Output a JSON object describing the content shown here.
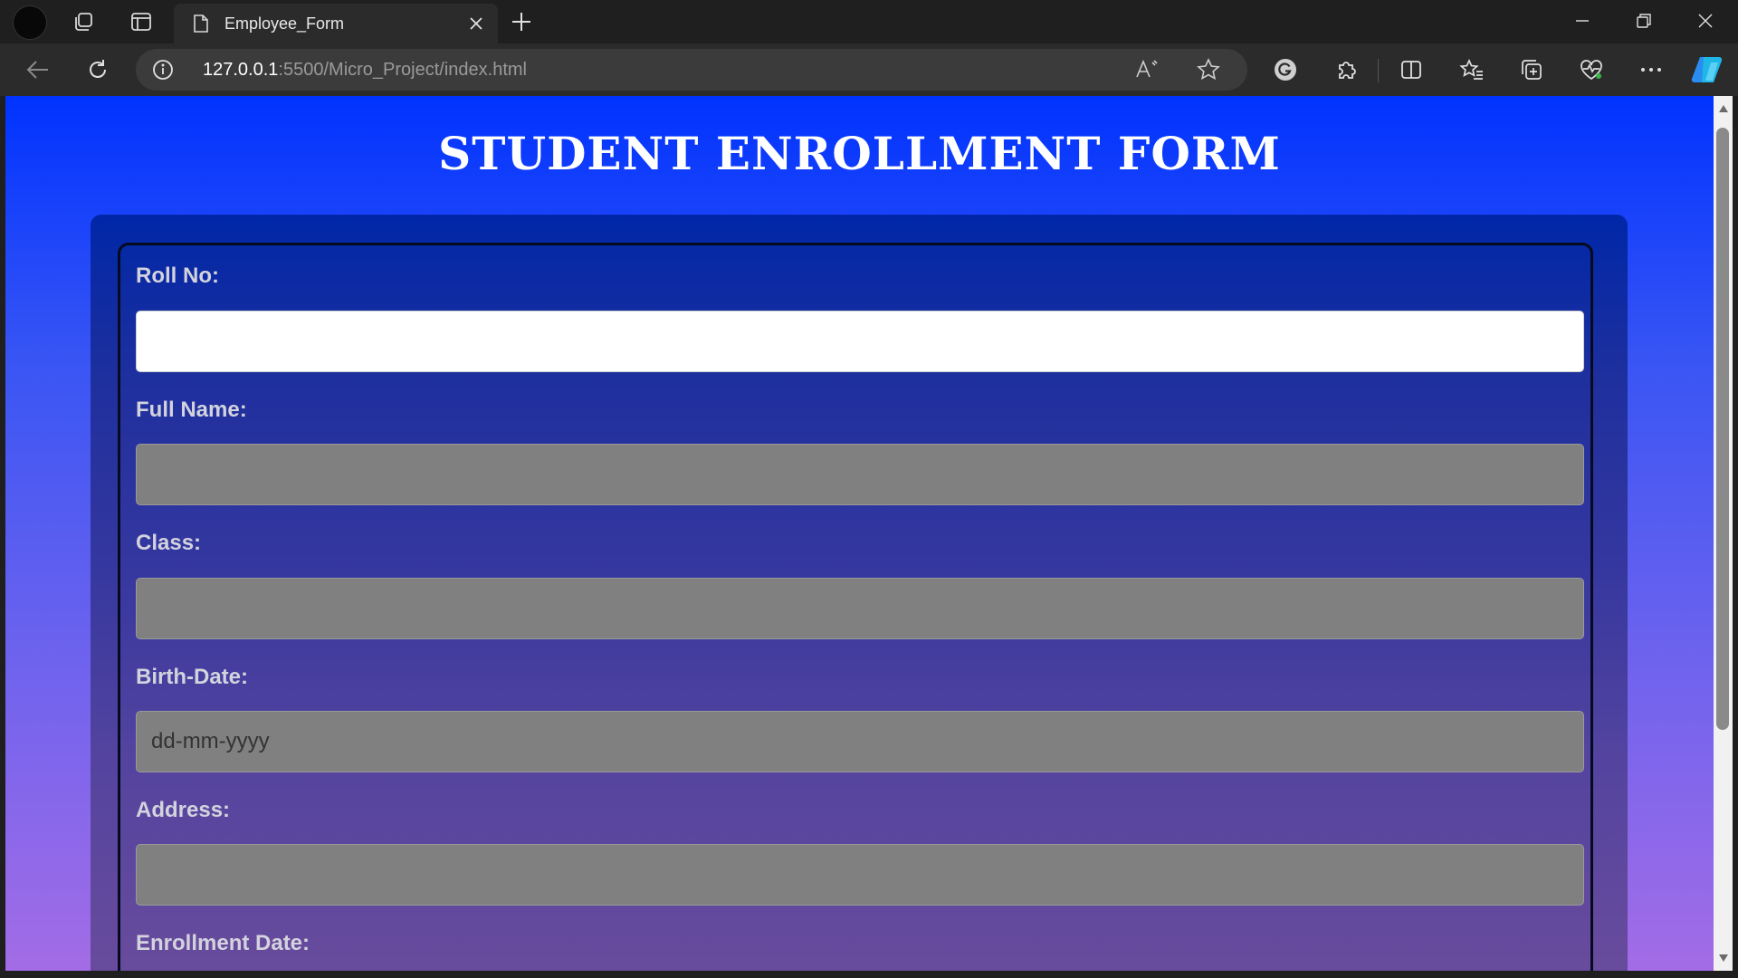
{
  "browser": {
    "tab_title": "Employee_Form",
    "url_host": "127.0.0.1",
    "url_path": ":5500/Micro_Project/index.html",
    "icons": {
      "tab_actions": "tab-actions-icon",
      "vertical_tabs": "vertical-tabs-icon",
      "page": "page-icon",
      "close": "close-icon",
      "new_tab": "plus-icon",
      "minimize": "minimize-icon",
      "restore": "restore-icon",
      "window_close": "close-icon",
      "back": "back-arrow-icon",
      "refresh": "refresh-icon",
      "info": "info-icon",
      "read_aloud": "read-aloud-icon",
      "favorite": "star-icon",
      "grammarly": "grammarly-icon",
      "extensions": "puzzle-icon",
      "split_screen": "split-screen-icon",
      "favorites": "favorites-icon",
      "collections": "collections-icon",
      "health": "heart-pulse-icon",
      "more": "more-icon",
      "copilot": "copilot-icon"
    }
  },
  "page": {
    "title": "STUDENT ENROLLMENT FORM",
    "colors": {
      "gradient_top": "#0033ff",
      "gradient_bottom": "#a36ce6",
      "input_bg": "#808080",
      "input_focused_bg": "#ffffff"
    },
    "fields": [
      {
        "label": "Roll No:",
        "value": ""
      },
      {
        "label": "Full Name:",
        "value": ""
      },
      {
        "label": "Class:",
        "value": ""
      },
      {
        "label": "Birth-Date:",
        "value": "dd-mm-yyyy"
      },
      {
        "label": "Address:",
        "value": ""
      },
      {
        "label": "Enrollment Date:",
        "value": ""
      }
    ]
  }
}
